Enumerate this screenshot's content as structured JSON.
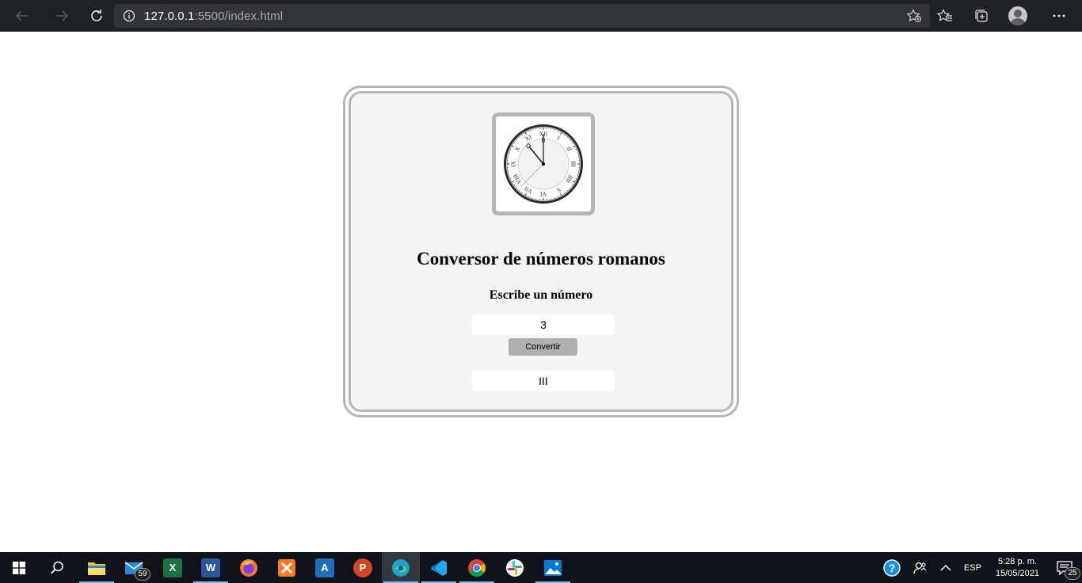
{
  "browser": {
    "url_host": "127.0.0.1",
    "url_path": ":5500/index.html",
    "icons": {
      "back": "back-arrow-icon",
      "forward": "forward-arrow-icon",
      "refresh": "refresh-icon",
      "info": "info-icon",
      "favorite_add": "add-favorite-icon",
      "favorites": "favorites-icon",
      "collections": "collections-icon",
      "profile": "profile-avatar",
      "menu": "more-options-icon"
    }
  },
  "app": {
    "title": "Conversor de números romanos",
    "prompt": "Escribe un número",
    "input_value": "3",
    "button_label": "Convertir",
    "result": "III",
    "clock_numerals": [
      "XII",
      "I",
      "II",
      "III",
      "IIII",
      "V",
      "VI",
      "VII",
      "VIII",
      "IX",
      "X",
      "XI"
    ]
  },
  "taskbar": {
    "apps": [
      {
        "name": "file-explorer",
        "color": "#f3c13a"
      },
      {
        "name": "mail",
        "color": "#2b88d8",
        "badge": "59"
      },
      {
        "name": "excel",
        "color": "#1d7044",
        "letter": "X"
      },
      {
        "name": "word",
        "color": "#2b579a",
        "letter": "W"
      },
      {
        "name": "firefox",
        "color": "#ff7139"
      },
      {
        "name": "xampp",
        "color": "#fb7a24"
      },
      {
        "name": "arduino-like-a",
        "color": "#1e6fb8",
        "letter": "A"
      },
      {
        "name": "powerpoint",
        "color": "#d24726",
        "letter": "P"
      },
      {
        "name": "edge",
        "color": "#1fa0c9"
      },
      {
        "name": "vscode",
        "color": "#23a9f2"
      },
      {
        "name": "chrome",
        "color": "#db4437"
      },
      {
        "name": "slack",
        "color": "#e01e5a"
      },
      {
        "name": "photos",
        "color": "#0078d4"
      }
    ],
    "tray": {
      "language": "ESP",
      "time": "5:28 p. m.",
      "date": "15/05/2021",
      "notifications": "25"
    }
  }
}
